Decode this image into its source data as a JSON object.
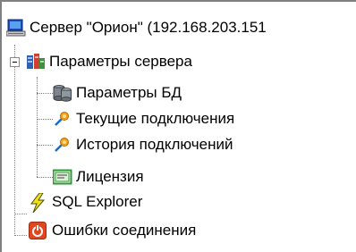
{
  "tree": {
    "root": {
      "label": "Сервер \"Орион\" (192.168.203.151",
      "icon": "computer-icon"
    },
    "server_params": {
      "label": "Параметры сервера",
      "icon": "server-settings-icon"
    },
    "db_params": {
      "label": "Параметры БД",
      "icon": "database-icon"
    },
    "current_connections": {
      "label": "Текущие подключения",
      "icon": "connection-plug-icon"
    },
    "connection_history": {
      "label": "История подключений",
      "icon": "connection-plug-icon"
    },
    "license": {
      "label": "Лицензия",
      "icon": "license-certificate-icon"
    },
    "sql_explorer": {
      "label": "SQL Explorer",
      "icon": "lightning-icon"
    },
    "connection_errors": {
      "label": "Ошибки соединения",
      "icon": "error-power-icon"
    }
  },
  "colors": {
    "error_red": "#e2461e",
    "lightning_yellow": "#f2e01a",
    "license_green": "#2e9a3a",
    "plug_orange": "#f0a020"
  }
}
